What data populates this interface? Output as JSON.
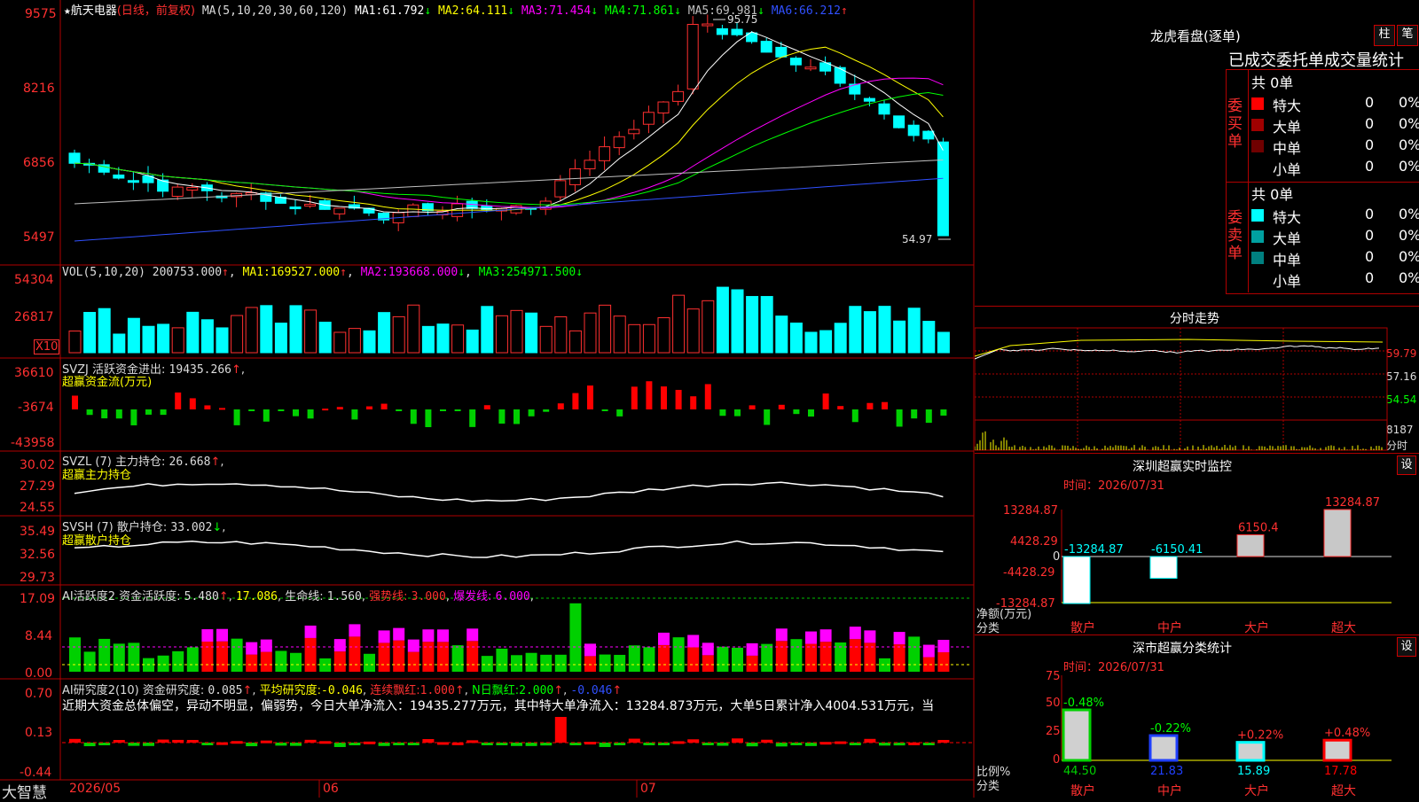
{
  "app": {
    "logo": "大智慧",
    "top_price": "9575"
  },
  "header": {
    "star": "★",
    "stock_name": "航天电器",
    "period": "(日线，前复权)",
    "ma_params": "MA(5,10,20,30,60,120)",
    "ma": [
      {
        "label": "MA1:",
        "value": "61.792",
        "dir": "↓",
        "color": "#ffffff"
      },
      {
        "label": "MA2:",
        "value": "64.111",
        "dir": "↓",
        "color": "#ffff00"
      },
      {
        "label": "MA3:",
        "value": "71.454",
        "dir": "↓",
        "color": "#ff00ff"
      },
      {
        "label": "MA4:",
        "value": "71.861",
        "dir": "↓",
        "color": "#00ff00"
      },
      {
        "label": "MA5:",
        "value": "69.981",
        "dir": "↓",
        "color": "#c0c0c0"
      },
      {
        "label": "MA6:",
        "value": "66.212",
        "dir": "↑",
        "color": "#3050ff"
      }
    ]
  },
  "price_panel": {
    "y_ticks": [
      "8216",
      "6856",
      "5497"
    ],
    "high_label": "95.75",
    "low_label": "54.97"
  },
  "vol_panel": {
    "title": "VOL(5,10,20)",
    "value": "200753.000",
    "ma": [
      {
        "label": "MA1:",
        "value": "169527.000",
        "dir": "↑",
        "color": "#ffff00"
      },
      {
        "label": "MA2:",
        "value": "193668.000",
        "dir": "↓",
        "color": "#ff00ff"
      },
      {
        "label": "MA3:",
        "value": "254971.500",
        "dir": "↓",
        "color": "#00ff00"
      }
    ],
    "y_ticks": [
      "54304",
      "26817"
    ],
    "unit": "X10"
  },
  "svzj_panel": {
    "title": "SVZJ  活跃资金进出:",
    "value": "19435.266",
    "dir": "↑",
    "name": "超赢资金流(万元)",
    "y_ticks": [
      "36610",
      "-3674",
      "-43958"
    ]
  },
  "svzl_panel": {
    "title": "SVZL (7) 主力持仓:",
    "value": "26.668",
    "dir": "↑",
    "name": "超赢主力持仓",
    "y_ticks": [
      "30.02",
      "27.29",
      "24.55"
    ]
  },
  "svsh_panel": {
    "title": "SVSH (7) 散户持仓:",
    "value": "33.002",
    "dir": "↓",
    "name": "超赢散户持仓",
    "y_ticks": [
      "35.49",
      "32.56",
      "29.73"
    ]
  },
  "ai1_panel": {
    "title": "AI活跃度2 资金活跃度:",
    "value": "5.480",
    "dir": "↑",
    "v2": "17.086",
    "life_label": "生命线:",
    "life_value": "1.560",
    "strong_label": "强势线:",
    "strong_value": "3.000",
    "burst_label": "爆发线:",
    "burst_value": "6.000",
    "y_ticks": [
      "17.09",
      "8.44",
      "0.00"
    ]
  },
  "ai2_panel": {
    "title": "AI研究度2(10) 资金研究度:",
    "value": "0.085",
    "dir": "↑",
    "avg_label": "平均研究度:",
    "avg_value": "-0.046",
    "cont_label": "连续飘红:",
    "cont_value": "1.000",
    "nred_label": "N日飘红:",
    "nred_value": "2.000",
    "tail_value": "-0.046",
    "comment": "近期大资金总体偏空，异动不明显，偏弱势，今日大单净流入：19435.277万元，其中特大单净流入：13284.873万元，大单5日累计净入4004.531万元，当",
    "y_ticks": [
      "0.70",
      "0.13",
      "-0.44"
    ]
  },
  "x_axis": {
    "labels": [
      "2026/05",
      "06",
      "07"
    ]
  },
  "dragon": {
    "title": "龙虎看盘(逐单)",
    "tabs": [
      "柱",
      "笔"
    ],
    "subtitle": "已成交委托单成交量统计",
    "buy_label": "委买单",
    "sell_label": "委卖单",
    "buy_total": "共 0单",
    "sell_total": "共 0单",
    "buy_rows": [
      {
        "name": "特大",
        "count": "0",
        "pct": "0%",
        "color": "#ff0000"
      },
      {
        "name": "大单",
        "count": "0",
        "pct": "0%",
        "color": "#a00000"
      },
      {
        "name": "中单",
        "count": "0",
        "pct": "0%",
        "color": "#700000"
      },
      {
        "name": "小单",
        "count": "0",
        "pct": "0%",
        "color": "#000000"
      }
    ],
    "sell_rows": [
      {
        "name": "特大",
        "count": "0",
        "pct": "0%",
        "color": "#00ffff"
      },
      {
        "name": "大单",
        "count": "0",
        "pct": "0%",
        "color": "#00a0a0"
      },
      {
        "name": "中单",
        "count": "0",
        "pct": "0%",
        "color": "#008080"
      },
      {
        "name": "小单",
        "count": "0",
        "pct": "0%",
        "color": "#000000"
      }
    ]
  },
  "intraday": {
    "title": "分时走势",
    "y_ticks": [
      "59.79",
      "57.16",
      "54.54",
      "8187"
    ],
    "vol_unit": "分时"
  },
  "monitor": {
    "title": "深圳超赢实时监控",
    "btn": "设",
    "time_label": "时间：2026/07/31",
    "y_ticks": [
      "13284.87",
      "4428.29",
      "0",
      "-4428.29",
      "-13284.87"
    ],
    "y_name": "净额(万元)",
    "x_name": "分类",
    "categories": [
      "散户",
      "中户",
      "大户",
      "超大"
    ],
    "bar_labels": [
      "-13284.87",
      "-6150.41",
      "6150.4",
      "13284.87"
    ]
  },
  "stats": {
    "title": "深市超赢分类统计",
    "btn": "设",
    "time_label": "时间：2026/07/31",
    "y_ticks": [
      "75",
      "50",
      "25",
      "0"
    ],
    "y_name": "比例%",
    "x_name": "分类",
    "categories": [
      "散户",
      "中户",
      "大户",
      "超大"
    ],
    "change_labels": [
      "-0.48%",
      "-0.22%",
      "+0.22%",
      "+0.48%"
    ],
    "value_labels": [
      "44.50",
      "21.83",
      "15.89",
      "17.78"
    ]
  },
  "chart_data": [
    {
      "type": "candlestick",
      "title": "航天电器 (日线，前复权)",
      "x": [
        "2026/05",
        "06",
        "07"
      ],
      "high": 95.75,
      "low": 54.97,
      "last_ma": {
        "MA1": 61.792,
        "MA2": 64.111,
        "MA3": 71.454,
        "MA4": 71.861,
        "MA5": 69.981,
        "MA6": 66.212
      }
    },
    {
      "type": "bar",
      "title": "深圳超赢实时监控",
      "categories": [
        "散户",
        "中户",
        "大户",
        "超大"
      ],
      "values": [
        -13284.87,
        -6150.41,
        6150.4,
        13284.87
      ],
      "ylabel": "净额(万元)",
      "ylim": [
        -13284.87,
        13284.87
      ]
    },
    {
      "type": "bar",
      "title": "深市超赢分类统计",
      "categories": [
        "散户",
        "中户",
        "大户",
        "超大"
      ],
      "values": [
        44.5,
        21.83,
        15.89,
        17.78
      ],
      "changes": [
        "-0.48%",
        "-0.22%",
        "+0.22%",
        "+0.48%"
      ],
      "ylabel": "比例%",
      "ylim": [
        0,
        75
      ]
    }
  ]
}
